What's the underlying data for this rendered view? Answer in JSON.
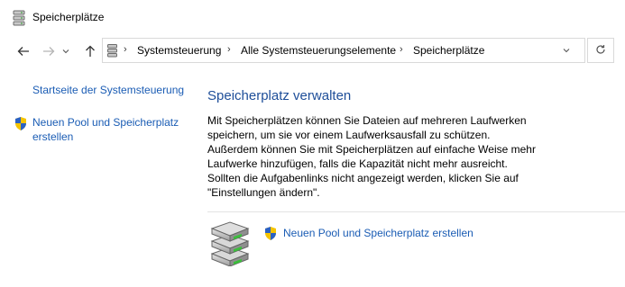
{
  "window": {
    "title": "Speicherplätze",
    "icon": "storage-spaces-icon"
  },
  "nav": {
    "back_icon": "back-arrow-icon",
    "forward_icon": "forward-arrow-icon",
    "recent_icon": "chevron-down-icon",
    "up_icon": "up-arrow-icon",
    "refresh_icon": "refresh-icon"
  },
  "breadcrumb": {
    "items": [
      "Systemsteuerung",
      "Alle Systemsteuerungselemente",
      "Speicherplätze"
    ]
  },
  "sidebar": {
    "home_link": "Startseite der Systemsteuerung",
    "create_link": "Neuen Pool und Speicherplatz erstellen",
    "create_icon": "uac-shield-icon"
  },
  "main": {
    "heading": "Speicherplatz verwalten",
    "description": "Mit Speicherplätzen können Sie Dateien auf mehreren Laufwerken speichern, um sie vor einem Laufwerksausfall zu schützen. Außerdem können Sie mit Speicherplätzen auf einfache Weise mehr Laufwerke hinzufügen, falls die Kapazität nicht mehr ausreicht. Sollten die Aufgabenlinks nicht angezeigt werden, klicken Sie auf \"Einstellungen ändern\".",
    "task_link": "Neuen Pool und Speicherplatz erstellen",
    "task_icon": "uac-shield-icon",
    "illustration": "drive-stack-icon"
  },
  "colors": {
    "link": "#1a5cb4",
    "heading": "#1e4e99"
  }
}
